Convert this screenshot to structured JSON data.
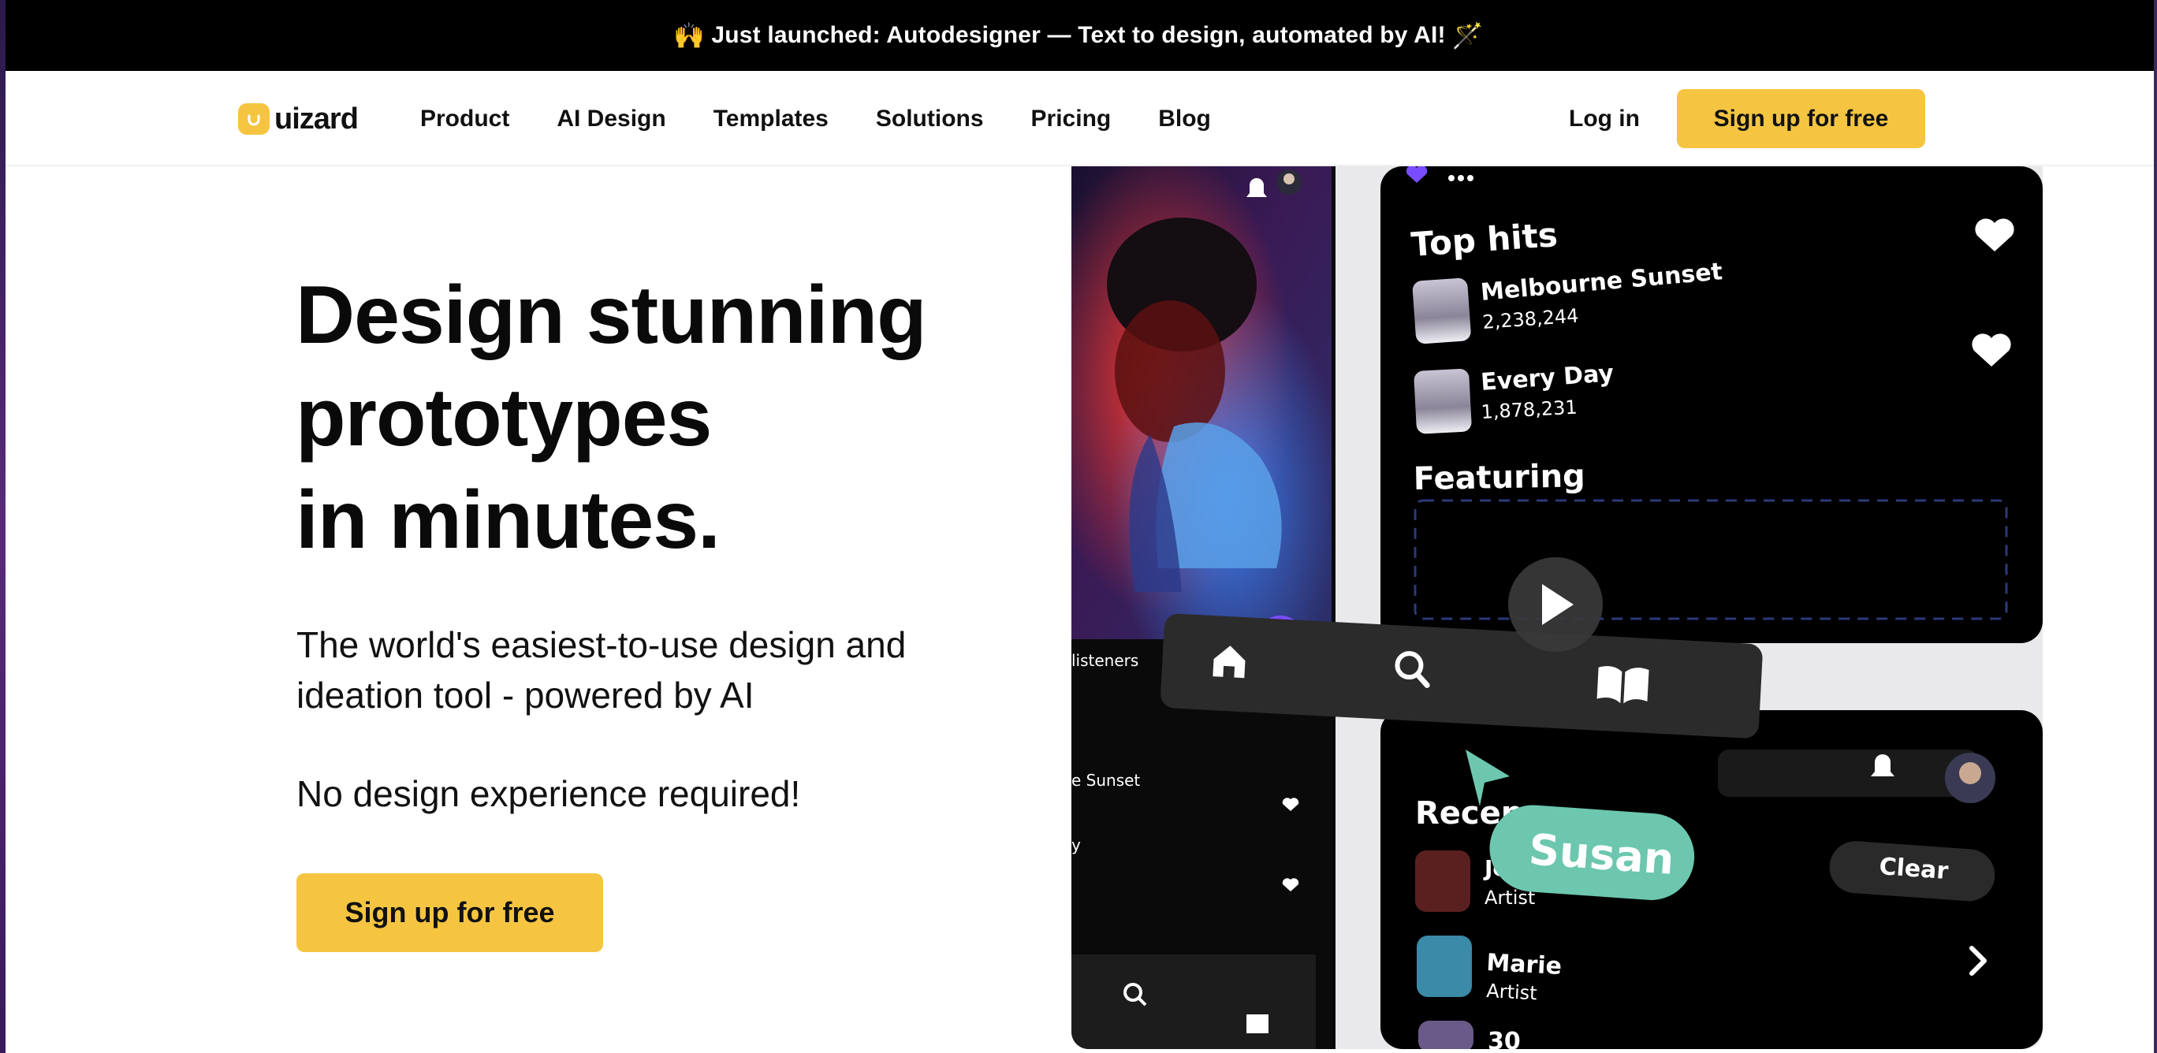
{
  "announcement": {
    "emoji_left": "🙌",
    "text": "Just launched: Autodesigner — Text to design, automated by AI!",
    "emoji_right": "🪄"
  },
  "nav": {
    "logo_text": "uizard",
    "links": [
      "Product",
      "AI Design",
      "Templates",
      "Solutions",
      "Pricing",
      "Blog"
    ],
    "login": "Log in",
    "cta": "Sign up for free"
  },
  "hero": {
    "title_lines": [
      "Design stunning",
      "prototypes",
      "in minutes."
    ],
    "subtitle_lines": [
      "The world's easiest-to-use design and",
      "ideation tool - powered by AI"
    ],
    "subtitle2": "No design experience required!",
    "cta": "Sign up for free"
  },
  "video": {
    "top_hits_label": "Top hits",
    "tracks": [
      {
        "title": "Melbourne Sunset",
        "plays": "2,238,244"
      },
      {
        "title": "Every Day",
        "plays": "1,878,231"
      }
    ],
    "featuring_label": "Featuring",
    "left_listeners": "listeners",
    "left_track": "e Sunset",
    "recent_label": "Recen",
    "cursor_name": "Susan",
    "clear_label": "Clear",
    "artists": [
      {
        "name": "Jo",
        "role": "Artist"
      },
      {
        "name": "Marie",
        "role": "Artist"
      },
      {
        "name": "30",
        "role": ""
      }
    ],
    "colors": {
      "accent": "#f5c542",
      "cursor": "#6cc7ae",
      "purple": "#7a4cff"
    }
  }
}
